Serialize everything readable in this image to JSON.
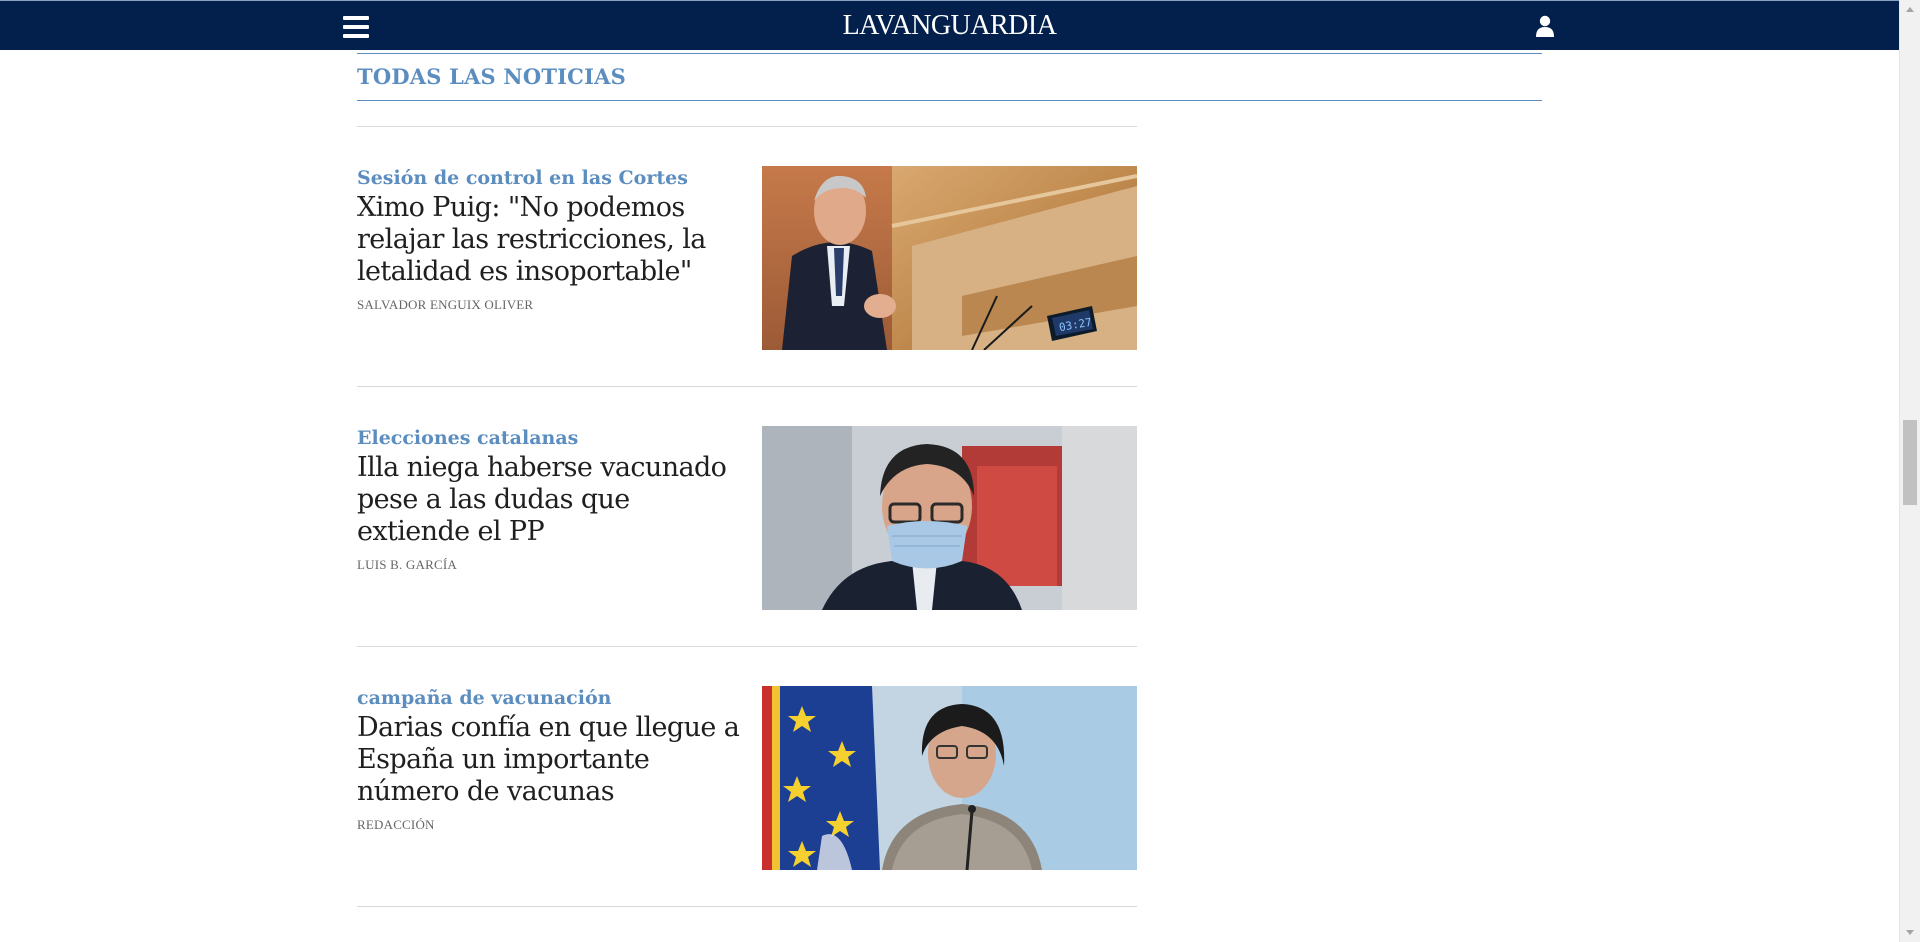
{
  "header": {
    "logo_text": "LAVANGUARDIA",
    "brand_color": "#03204d",
    "menu_icon": "hamburger-menu-icon",
    "user_icon": "user-icon"
  },
  "section": {
    "title": "TODAS LAS NOTICIAS",
    "accent_color": "#5b8dbf"
  },
  "articles": [
    {
      "kicker": "Sesión de control en las Cortes",
      "headline": "Ximo Puig: \"No podemos relajar las restricciones, la letalidad es insoportable\"",
      "author": "SALVADOR ENGUIX OLIVER",
      "image_alt": "Ximo Puig speaking at a parliament lectern",
      "image_timer_text": "03:27"
    },
    {
      "kicker": "Elecciones catalanas",
      "headline": "Illa niega haberse vacunado pese a las dudas que extiende el PP",
      "author": "LUIS B. GARCÍA",
      "image_alt": "Salvador Illa wearing a face mask"
    },
    {
      "kicker": "campaña de vacunación",
      "headline": "Darias confía en que llegue a España un importante número de vacunas",
      "author": "REDACCIÓN",
      "image_alt": "Carolina Darias at a press conference next to EU and Spanish flags"
    }
  ]
}
